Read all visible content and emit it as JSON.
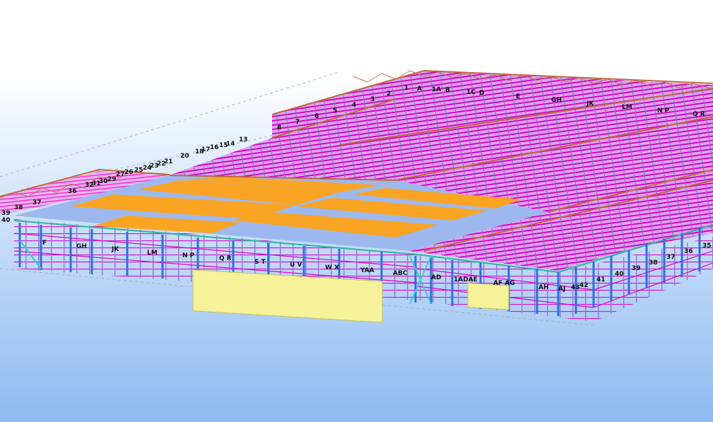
{
  "scene": {
    "description_colors": {
      "background_top": "#ffffff",
      "background_bottom": "#8fbcf2",
      "purlin_magenta": "#e000c8",
      "roof_orange": "#ffa31a",
      "roof_blue": "#8fb4f0",
      "column_blue": "#2f6fe0",
      "rafter_brown": "#c0683a",
      "cladding_cyan": "#39d0d0",
      "door_yellow": "#f6f29a"
    },
    "grid_labels_front": [
      "F",
      "GH",
      "JK",
      "LM",
      "N P",
      "Q R",
      "S T",
      "U V",
      "W X",
      "YAA",
      "ABC",
      "AD",
      "1ADAE",
      "AF AG",
      "AH",
      "AJ",
      "43",
      "42",
      "41",
      "40",
      "39",
      "38",
      "37",
      "36",
      "35"
    ],
    "grid_labels_back": [
      "1",
      "A",
      "1A",
      "B",
      "1C",
      "D",
      "E",
      "GH",
      "JK",
      "LM",
      "N P",
      "Q R",
      "2",
      "3",
      "4",
      "5",
      "6",
      "7",
      "8"
    ],
    "grid_labels_left": [
      "13",
      "14",
      "15",
      "16",
      "17",
      "18",
      "20",
      "21",
      "22",
      "23",
      "24",
      "25",
      "26",
      "27",
      "29",
      "30",
      "31",
      "32",
      "36",
      "37",
      "38",
      "39",
      "40"
    ]
  }
}
